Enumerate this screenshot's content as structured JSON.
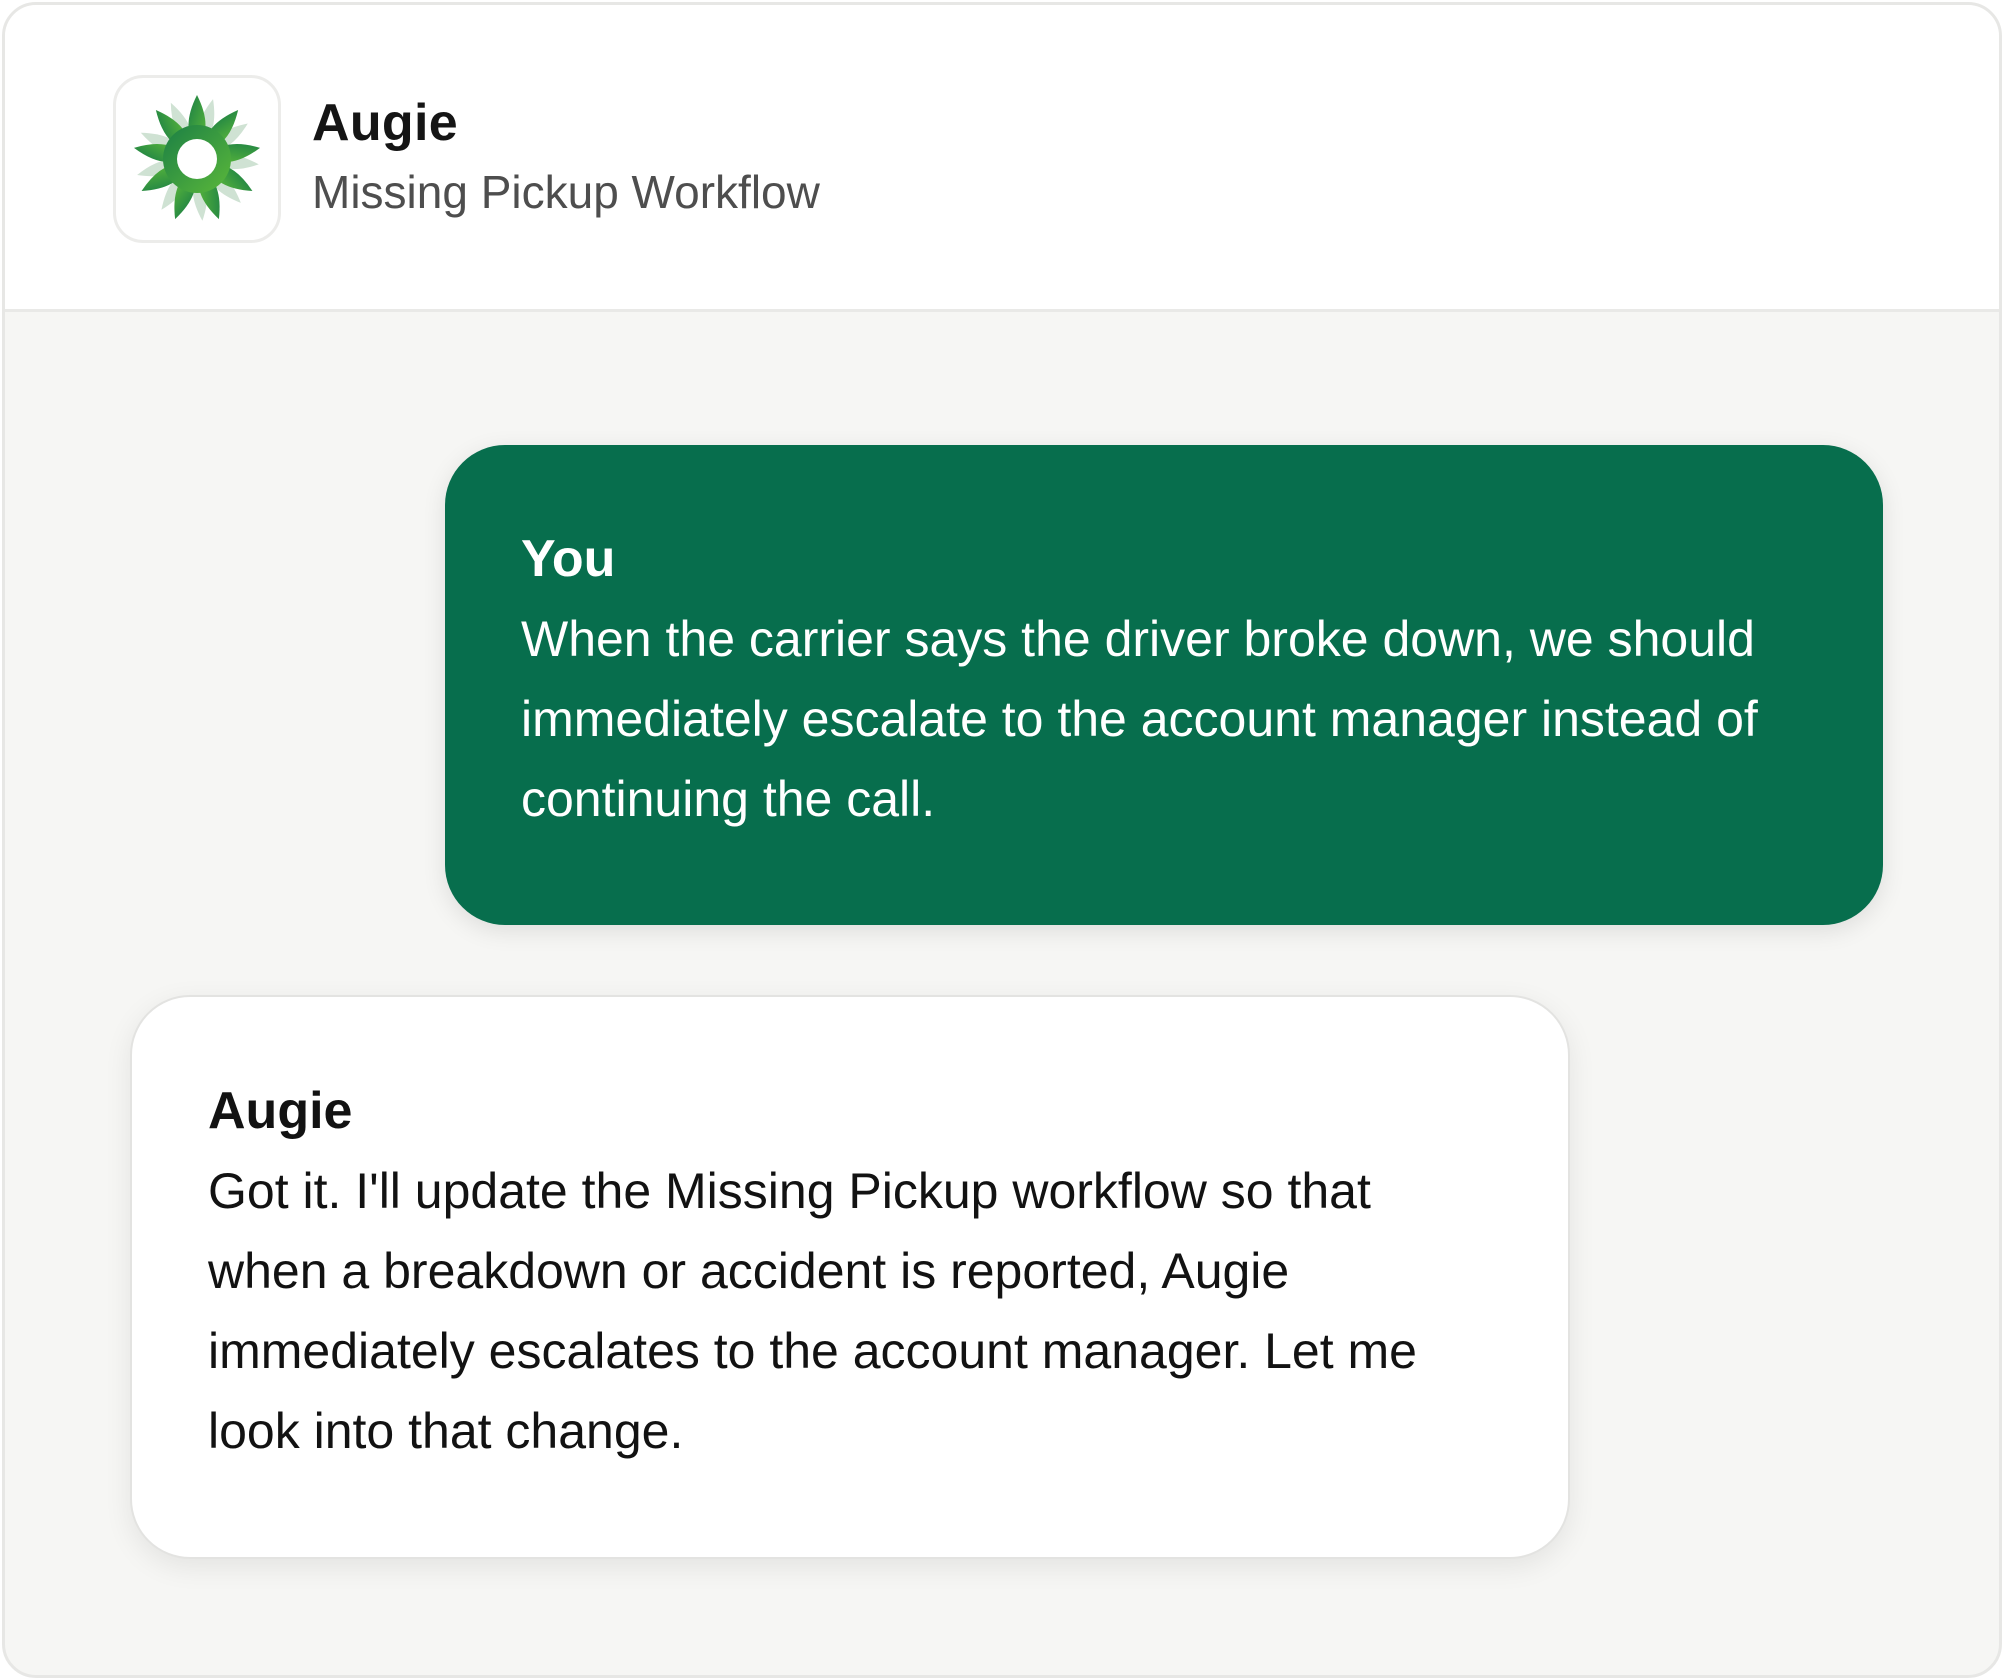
{
  "header": {
    "app_name": "Augie",
    "workflow_name": "Missing Pickup Workflow",
    "logo_icon": "flower-icon",
    "brand_colors": {
      "petal_dark": "#1b7f45",
      "petal_light": "#5bb83a",
      "petal_back": "#cfe2d3"
    }
  },
  "conversation": {
    "messages": [
      {
        "role": "user",
        "sender": "You",
        "text": "When the carrier says the driver broke down, we should immediately escalate to the account manager instead of continuing the call."
      },
      {
        "role": "assistant",
        "sender": "Augie",
        "text": "Got it. I'll update the Missing Pickup workflow so that when a breakdown or accident is reported, Augie immediately escalates to the account manager. Let me look into that change."
      }
    ]
  },
  "colors": {
    "user_bubble": "#076e4d",
    "assistant_bubble": "#ffffff",
    "canvas_background": "#f6f6f4"
  }
}
